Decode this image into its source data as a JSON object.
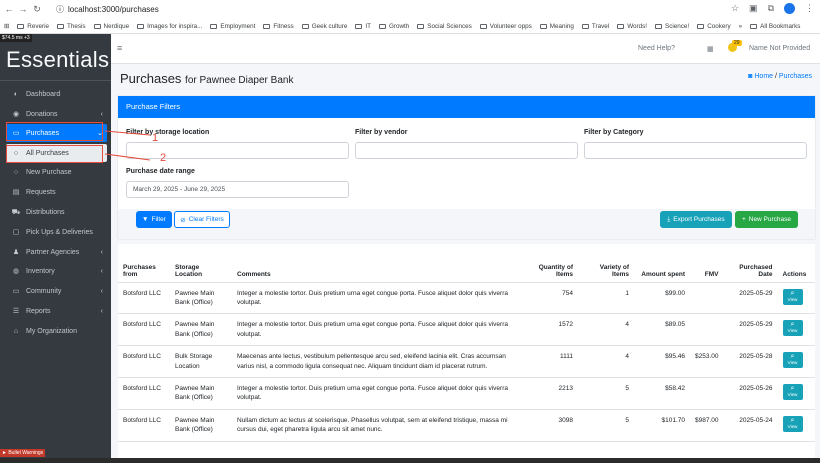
{
  "browser": {
    "url": "localhost:3000/purchases",
    "bookmarks": [
      "Reverie",
      "Thesis",
      "Nerdique",
      "Images for inspira...",
      "Employment",
      "Fitness",
      "Geek culture",
      "IT",
      "Growth",
      "Social Sciences",
      "Volunteer opps",
      "Meaning",
      "Travel",
      "Words!",
      "Science!",
      "Cookery",
      "All Bookmarks"
    ],
    "overflow": "»"
  },
  "sidebar": {
    "fps": "$74.5 ms +3",
    "brand": "Essentials",
    "debug": "► Bullet Warnings",
    "items": [
      {
        "label": "Dashboard",
        "icon": "dashboard-icon",
        "glyph": "◐"
      },
      {
        "label": "Donations",
        "icon": "donations-icon",
        "glyph": "◉",
        "chev": "‹"
      },
      {
        "label": "Purchases",
        "icon": "purchases-icon",
        "glyph": "▭",
        "chev": "⌄"
      },
      {
        "label": "All Purchases",
        "icon": "circle-icon",
        "glyph": "○"
      },
      {
        "label": "New Purchase",
        "icon": "circle-icon",
        "glyph": "○"
      },
      {
        "label": "Requests",
        "icon": "file-icon",
        "glyph": "▤"
      },
      {
        "label": "Distributions",
        "icon": "cart-icon",
        "glyph": "⛟"
      },
      {
        "label": "Pick Ups & Deliveries",
        "icon": "calendar-icon",
        "glyph": "▢"
      },
      {
        "label": "Partner Agencies",
        "icon": "users-icon",
        "glyph": "♟",
        "chev": "‹"
      },
      {
        "label": "Inventory",
        "icon": "globe-icon",
        "glyph": "◍",
        "chev": "‹"
      },
      {
        "label": "Community",
        "icon": "monitor-icon",
        "glyph": "▭",
        "chev": "‹"
      },
      {
        "label": "Reports",
        "icon": "list-icon",
        "glyph": "☰",
        "chev": "‹"
      },
      {
        "label": "My Organization",
        "icon": "home-icon",
        "glyph": "⌂"
      }
    ]
  },
  "topnav": {
    "help": "Need Help?",
    "badge": "29",
    "user": "Name Not Provided"
  },
  "page": {
    "title": "Purchases",
    "subtitle": "for Pawnee Diaper Bank",
    "crumb_home": "Home",
    "crumb_sep": "/",
    "crumb_current": "Purchases"
  },
  "filters": {
    "header": "Purchase Filters",
    "storage_label": "Filter by storage location",
    "vendor_label": "Filter by vendor",
    "category_label": "Filter by Category",
    "date_label": "Purchase date range",
    "date_value": "March 29, 2025 - June 29, 2025",
    "filter_btn": "Filter",
    "clear_btn": "Clear Filters",
    "export_btn": "Export Purchases",
    "new_btn": "New Purchase"
  },
  "table": {
    "headers": {
      "from": "Purchases from",
      "location": "Storage Location",
      "comments": "Comments",
      "qty": "Quantity of Items",
      "variety": "Variety of Items",
      "spent": "Amount spent",
      "fmv": "FMV",
      "date": "Purchased Date",
      "actions": "Actions"
    },
    "view_label": "View",
    "rows": [
      {
        "from": "Botsford LLC",
        "location": "Pawnee Main Bank (Office)",
        "comments": "Integer a molestie tortor. Duis pretium urna eget congue porta. Fusce aliquet dolor quis viverra volutpat.",
        "qty": "754",
        "variety": "1",
        "spent": "$99.00",
        "fmv": "",
        "date": "2025-05-29"
      },
      {
        "from": "Botsford LLC",
        "location": "Pawnee Main Bank (Office)",
        "comments": "Integer a molestie tortor. Duis pretium urna eget congue porta. Fusce aliquet dolor quis viverra volutpat.",
        "qty": "1572",
        "variety": "4",
        "spent": "$89.05",
        "fmv": "",
        "date": "2025-05-29"
      },
      {
        "from": "Botsford LLC",
        "location": "Bulk Storage Location",
        "comments": "Maecenas ante lectus, vestibulum pellentesque arcu sed, eleifend lacinia elit. Cras accumsan varius nisl, a commodo ligula consequat nec. Aliquam tincidunt diam id placerat rutrum.",
        "qty": "1111",
        "variety": "4",
        "spent": "$95.46",
        "fmv": "$253.00",
        "date": "2025-05-28"
      },
      {
        "from": "Botsford LLC",
        "location": "Pawnee Main Bank (Office)",
        "comments": "Integer a molestie tortor. Duis pretium urna eget congue porta. Fusce aliquet dolor quis viverra volutpat.",
        "qty": "2213",
        "variety": "5",
        "spent": "$58.42",
        "fmv": "",
        "date": "2025-05-26"
      },
      {
        "from": "Botsford LLC",
        "location": "Pawnee Main Bank (Office)",
        "comments": "Nullam dictum ac lectus at scelerisque. Phasellus volutpat, sem at eleifend tristique, massa mi cursus dui, eget pharetra ligula arcu sit amet nunc.",
        "qty": "3098",
        "variety": "5",
        "spent": "$101.70",
        "fmv": "$987.00",
        "date": "2025-05-24"
      }
    ]
  },
  "annotations": {
    "one": "1",
    "two": "2"
  }
}
